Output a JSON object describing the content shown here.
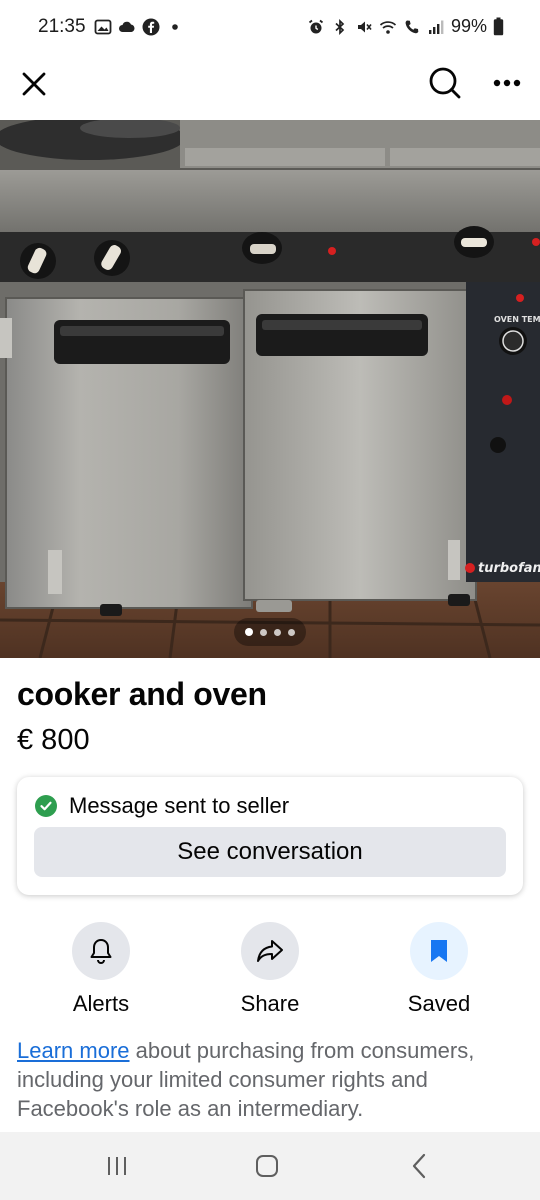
{
  "status_bar": {
    "time": "21:35",
    "battery": "99%",
    "left_icons": [
      "image-icon",
      "cloud-icon",
      "facebook-icon",
      "dot-icon"
    ],
    "right_icons": [
      "alarm-icon",
      "bluetooth-icon",
      "mute-icon",
      "wifi-icon",
      "call-icon",
      "signal-icon",
      "battery-icon"
    ]
  },
  "top_bar": {
    "icons": [
      "close-icon",
      "search-icon",
      "more-icon"
    ]
  },
  "photo": {
    "carousel_count": 4,
    "active_index": 0,
    "brand_text": "turbofan",
    "dial_label": "OVEN TEMP"
  },
  "listing": {
    "title": "cooker and oven",
    "price": "€ 800"
  },
  "message_card": {
    "status_text": "Message sent to seller",
    "button_label": "See conversation"
  },
  "actions": [
    {
      "label": "Alerts",
      "icon": "bell-icon"
    },
    {
      "label": "Share",
      "icon": "share-icon"
    },
    {
      "label": "Saved",
      "icon": "bookmark-icon"
    }
  ],
  "disclaimer": {
    "link_text": "Learn more",
    "text": " about purchasing from consumers, including your limited consumer rights and Facebook's role as an intermediary."
  },
  "nav_bar": {
    "icons": [
      "recents-icon",
      "home-icon",
      "back-icon"
    ]
  },
  "colors": {
    "accent_blue": "#1877f2",
    "link_blue": "#1a6ed8",
    "success_green": "#2e9e4f",
    "button_gray": "#e4e6eb"
  }
}
